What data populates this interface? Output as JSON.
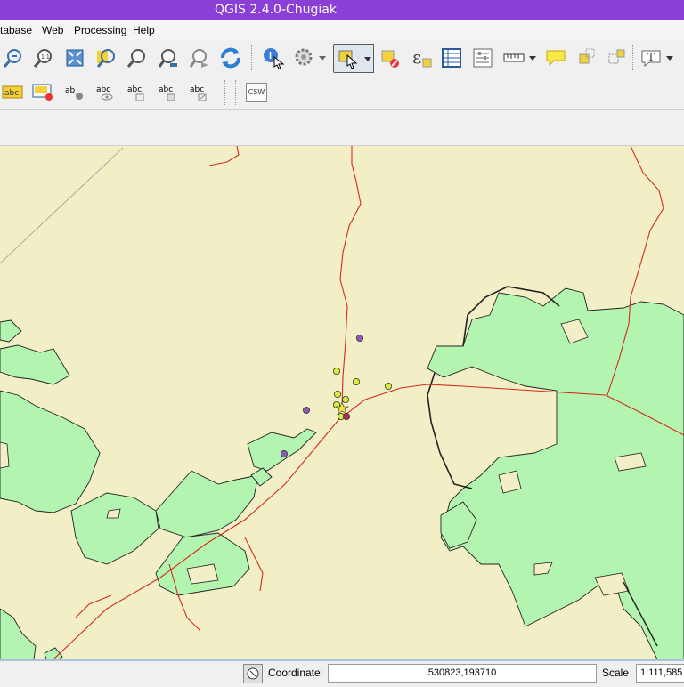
{
  "window": {
    "title": "QGIS 2.4.0-Chugiak"
  },
  "menu": {
    "items": [
      {
        "label": "tabase"
      },
      {
        "label": "Web"
      },
      {
        "label": "Processing"
      },
      {
        "label": "Help"
      }
    ]
  },
  "toolbar": {
    "csw_label": "CSW",
    "label_tool_text": "abc"
  },
  "status": {
    "coordinate_label": "Coordinate:",
    "coordinate_value": "530823,193710",
    "scale_label": "Scale",
    "scale_value": "1:111,585"
  },
  "colors": {
    "title_bar": "#8a3fd6",
    "map_background": "#f2efc7",
    "polygon_fill": "#b3f5b0",
    "road": "#d42a1c",
    "point_yellow": "#d8ee3c",
    "point_purple": "#8a5ab4"
  }
}
